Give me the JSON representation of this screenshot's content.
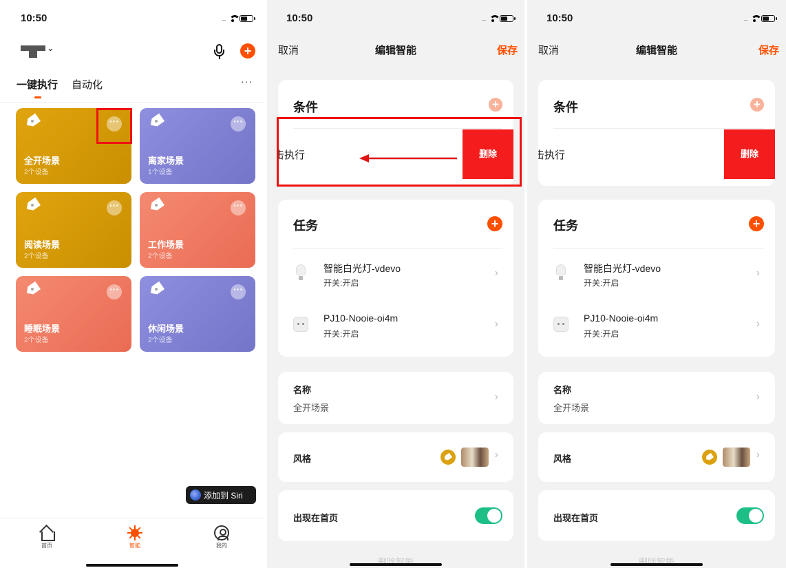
{
  "status": {
    "time": "10:50"
  },
  "home": {
    "tabs": [
      "一键执行",
      "自动化"
    ],
    "more": "···",
    "scenes": [
      {
        "name": "全开场景",
        "sub": "2个设备"
      },
      {
        "name": "离家场景",
        "sub": "1个设备"
      },
      {
        "name": "阅读场景",
        "sub": "2个设备"
      },
      {
        "name": "工作场景",
        "sub": "2个设备"
      },
      {
        "name": "睡眠场景",
        "sub": "2个设备"
      },
      {
        "name": "休闲场景",
        "sub": "2个设备"
      }
    ],
    "siri_label": "添加到 Siri",
    "tabbar": [
      "首页",
      "智能",
      "我的"
    ]
  },
  "edit": {
    "cancel": "取消",
    "title": "编辑智能",
    "save": "保存",
    "conditions_title": "条件",
    "condition_item": "点击执行",
    "condition_item_visible": "击执行",
    "delete": "删除",
    "tasks_title": "任务",
    "tasks": [
      {
        "name": "智能白光灯-vdevo",
        "state": "开关:开启"
      },
      {
        "name": "PJ10-Nooie-oi4m",
        "state": "开关:开启"
      }
    ],
    "name_label": "名称",
    "name_value": "全开场景",
    "style_label": "风格",
    "show_home_label": "出现在首页",
    "show_home_on": true,
    "delete_smart": "删除智能"
  },
  "colors": {
    "accent": "#fe5000",
    "delete_red": "#f41c1c",
    "toggle_green": "#1dbf86",
    "card_gold": "#d9a00a",
    "card_purple": "#8282d6",
    "card_coral": "#f07a62"
  },
  "icons": [
    "wifi-icon",
    "battery-icon",
    "mic-icon",
    "add-icon",
    "tag-icon",
    "more-icon",
    "home-icon",
    "smart-icon",
    "profile-icon",
    "bulb-icon",
    "plug-icon",
    "chevron-right-icon"
  ]
}
